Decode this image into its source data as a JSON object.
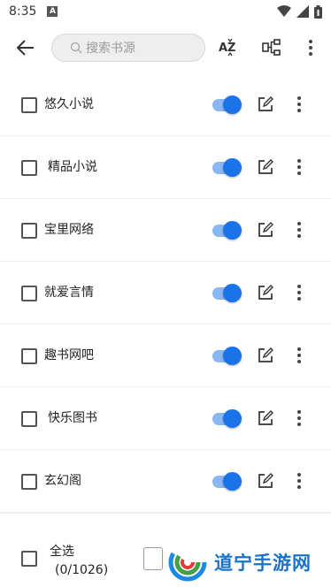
{
  "status_bar": {
    "time": "8:35",
    "notification_letter": "A"
  },
  "toolbar": {
    "search_placeholder": "搜索书源",
    "sort_icon_text": "AZ"
  },
  "sources": [
    {
      "name": "悠久小说",
      "enabled": true
    },
    {
      "name": "精品小说",
      "enabled": true
    },
    {
      "name": "宝里网络",
      "enabled": true
    },
    {
      "name": "就爱言情",
      "enabled": true
    },
    {
      "name": "趣书网吧",
      "enabled": true
    },
    {
      "name": "快乐图书",
      "enabled": true
    },
    {
      "name": "玄幻阁",
      "enabled": true
    }
  ],
  "bottom_bar": {
    "select_all_label": "全选",
    "selection_count": "(0/1026)"
  },
  "watermark": {
    "text": "道宁手游网"
  },
  "colors": {
    "accent": "#1a73e8",
    "track": "#8ab6f2"
  }
}
